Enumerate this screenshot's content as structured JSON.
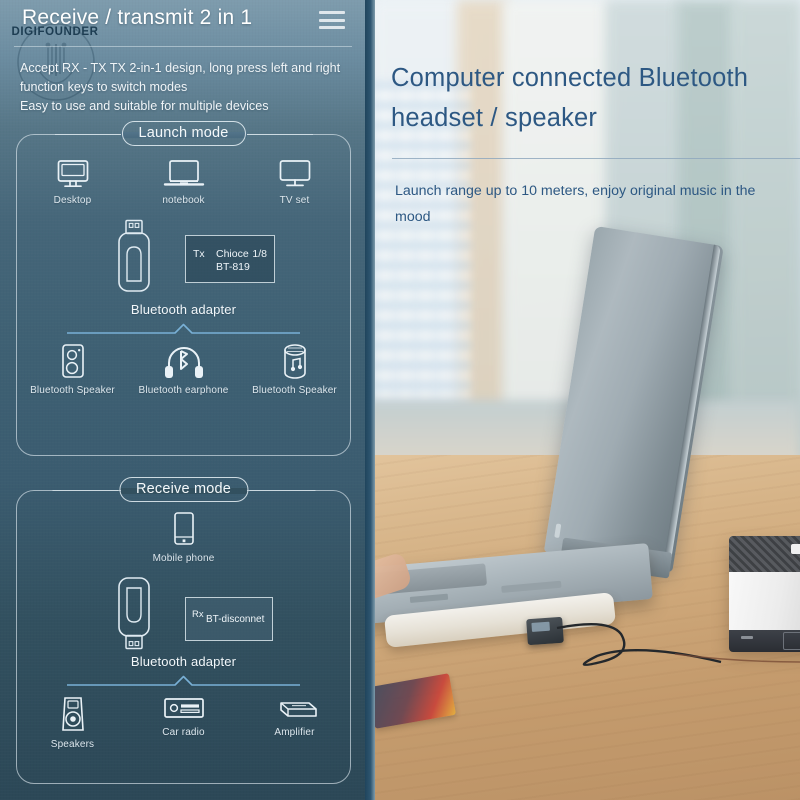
{
  "left_panel": {
    "header": {
      "title": "Receive / transmit 2 in 1",
      "menu_icon": "hamburger-menu-icon"
    },
    "watermark": {
      "text": "DIGIFOUNDER"
    },
    "intro_text": "Accept RX - TX TX 2-in-1 design, long press left and right function keys to switch modes\nEasy to use and suitable for multiple devices",
    "sections": [
      {
        "label": "Launch mode",
        "sources": [
          {
            "label": "Desktop",
            "icon": "desktop-monitor-icon"
          },
          {
            "label": "notebook",
            "icon": "laptop-icon"
          },
          {
            "label": "TV set",
            "icon": "tv-icon"
          }
        ],
        "device": {
          "label": "Bluetooth adapter",
          "icon": "usb-dongle-icon",
          "screen": {
            "mode": "Tx",
            "line1_middle": "Chioce",
            "line1_right": "1/8",
            "line2": "BT-819"
          }
        },
        "targets": [
          {
            "label": "Bluetooth Speaker",
            "icon": "bookshelf-speaker-icon"
          },
          {
            "label": "Bluetooth earphone",
            "icon": "bluetooth-headphones-icon"
          },
          {
            "label": "Bluetooth Speaker",
            "icon": "cylinder-speaker-icon"
          }
        ]
      },
      {
        "label": "Receive mode",
        "sources": [
          {
            "label": "Mobile phone",
            "icon": "mobile-phone-icon"
          }
        ],
        "device": {
          "label": "Bluetooth adapter",
          "icon": "usb-dongle-icon",
          "screen": {
            "mode": "Rx",
            "text": "BT-disconnet"
          }
        },
        "targets": [
          {
            "label": "Speakers",
            "icon": "studio-speaker-icon"
          },
          {
            "label": "Car radio",
            "icon": "car-radio-icon"
          },
          {
            "label": "Amplifier",
            "icon": "amplifier-icon"
          }
        ]
      }
    ]
  },
  "right_panel": {
    "headline": "Computer connected Bluetooth headset / speaker",
    "subtext": "Launch range up to 10 meters, enjoy original music in the mood",
    "photo_alt": "laptop-with-bluetooth-adapter-and-speaker-on-desk"
  },
  "colors": {
    "panel_bg_top": "#7e9cad",
    "panel_bg_bottom": "#2c4857",
    "headline_blue": "#2d5883",
    "outline_white": "#e4eef4",
    "brace_line": "#7fb6d8"
  }
}
